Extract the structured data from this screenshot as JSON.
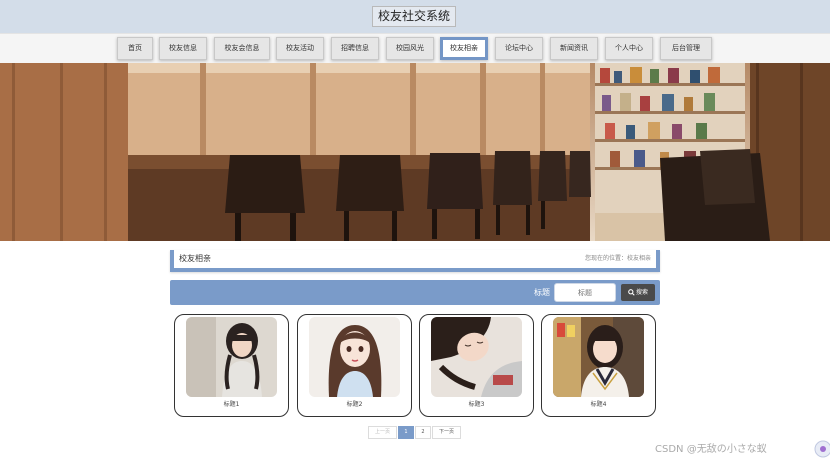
{
  "header": {
    "site_title": "校友社交系统"
  },
  "nav": {
    "items": [
      {
        "label": "首页"
      },
      {
        "label": "校友信息"
      },
      {
        "label": "校友会信息"
      },
      {
        "label": "校友活动"
      },
      {
        "label": "招聘信息"
      },
      {
        "label": "校园风光"
      },
      {
        "label": "校友相亲"
      },
      {
        "label": "论坛中心"
      },
      {
        "label": "新闻资讯"
      },
      {
        "label": "个人中心"
      },
      {
        "label": "后台管理"
      }
    ],
    "active_index": 6
  },
  "banner": {
    "slide_count": 3,
    "active_slide": 1
  },
  "section": {
    "title": "校友相亲",
    "breadcrumb_prefix": "您现在的位置：",
    "breadcrumb_current": "校友相亲"
  },
  "search": {
    "label": "标题",
    "placeholder": "标题",
    "button_label": "搜索"
  },
  "cards": [
    {
      "caption": "标题1"
    },
    {
      "caption": "标题2"
    },
    {
      "caption": "标题3"
    },
    {
      "caption": "标题4"
    }
  ],
  "pagination": {
    "prev_label": "上一页",
    "pages": [
      "1",
      "2"
    ],
    "current": "1",
    "next_label": "下一页"
  },
  "watermark": "CSDN @无敌の小さな蚁",
  "colors": {
    "accent": "#7a9bc9",
    "header_bg": "#d3dde9",
    "search_button": "#4a4a4a"
  }
}
